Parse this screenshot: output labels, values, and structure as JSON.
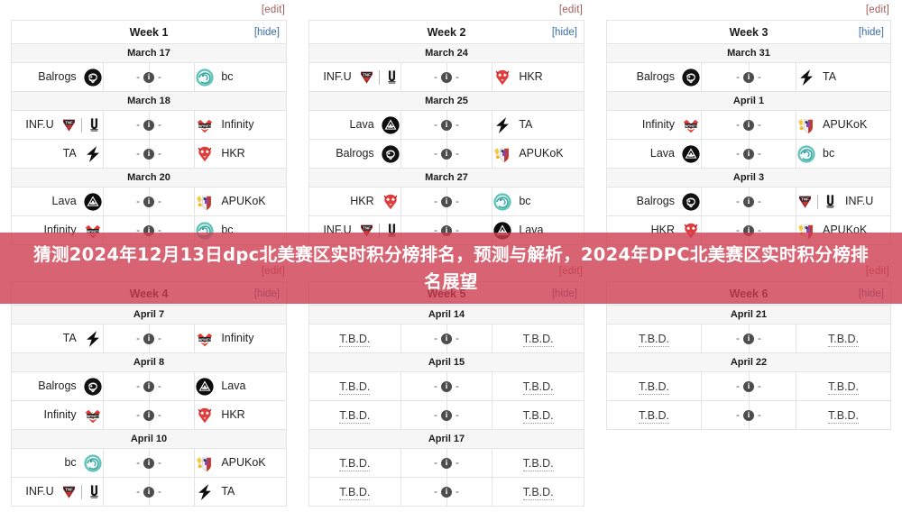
{
  "banner": {
    "text": "猜测2024年12月13日dpc北美赛区实时积分榜排名，预测与解析，2024年DPC北美赛区实时积分榜排名展望",
    "color": "#ce3c50"
  },
  "links": {
    "edit": "[edit]",
    "hide": "[hide]"
  },
  "labels": {
    "tbd": "T.B.D.",
    "score_dash": "-",
    "info": "i"
  },
  "weeks": [
    {
      "title": "Week 1",
      "groups": [
        {
          "date": "March 17",
          "matches": [
            {
              "left": "Balrogs",
              "left_logo": "balrogs-logo",
              "right": "bc",
              "right_logo": "bc-logo"
            }
          ]
        },
        {
          "date": "March 18",
          "matches": [
            {
              "left": "INF.U",
              "left_logo": "infu-dual-logo",
              "right": "Infinity",
              "right_logo": "infinity-logo"
            },
            {
              "left": "TA",
              "left_logo": "ta-logo",
              "right": "HKR",
              "right_logo": "hkr-logo"
            }
          ]
        },
        {
          "date": "March 20",
          "matches": [
            {
              "left": "Lava",
              "left_logo": "lava-logo",
              "right": "APUKoK",
              "right_logo": "apukok-logo"
            },
            {
              "left": "Infinity",
              "left_logo": "infinity-logo",
              "right": "bc",
              "right_logo": "bc-logo"
            }
          ]
        }
      ]
    },
    {
      "title": "Week 2",
      "groups": [
        {
          "date": "March 24",
          "matches": [
            {
              "left": "INF.U",
              "left_logo": "infu-dual-logo",
              "right": "HKR",
              "right_logo": "hkr-logo"
            }
          ]
        },
        {
          "date": "March 25",
          "matches": [
            {
              "left": "Lava",
              "left_logo": "lava-logo",
              "right": "TA",
              "right_logo": "ta-logo"
            },
            {
              "left": "Balrogs",
              "left_logo": "balrogs-logo",
              "right": "APUKoK",
              "right_logo": "apukok-logo"
            }
          ]
        },
        {
          "date": "March 27",
          "matches": [
            {
              "left": "HKR",
              "left_logo": "hkr-logo",
              "right": "bc",
              "right_logo": "bc-logo"
            },
            {
              "left": "INF.U",
              "left_logo": "infu-dual-logo",
              "right": "Lava",
              "right_logo": "lava-logo"
            }
          ]
        }
      ]
    },
    {
      "title": "Week 3",
      "groups": [
        {
          "date": "March 31",
          "matches": [
            {
              "left": "Balrogs",
              "left_logo": "balrogs-logo",
              "right": "TA",
              "right_logo": "ta-logo"
            }
          ]
        },
        {
          "date": "April 1",
          "matches": [
            {
              "left": "Infinity",
              "left_logo": "infinity-logo",
              "right": "APUKoK",
              "right_logo": "apukok-logo"
            },
            {
              "left": "Lava",
              "left_logo": "lava-logo",
              "right": "bc",
              "right_logo": "bc-logo"
            }
          ]
        },
        {
          "date": "April 3",
          "matches": [
            {
              "left": "Balrogs",
              "left_logo": "balrogs-logo",
              "right": "INF.U",
              "right_logo": "infu-dual-logo"
            },
            {
              "left": "HKR",
              "left_logo": "hkr-logo",
              "right": "APUKoK",
              "right_logo": "apukok-logo"
            }
          ]
        }
      ]
    },
    {
      "title": "Week 4",
      "groups": [
        {
          "date": "April 7",
          "matches": [
            {
              "left": "TA",
              "left_logo": "ta-logo",
              "right": "Infinity",
              "right_logo": "infinity-logo"
            }
          ]
        },
        {
          "date": "April 8",
          "matches": [
            {
              "left": "Balrogs",
              "left_logo": "balrogs-logo",
              "right": "Lava",
              "right_logo": "lava-logo"
            },
            {
              "left": "Infinity",
              "left_logo": "infinity-logo",
              "right": "HKR",
              "right_logo": "hkr-logo"
            }
          ]
        },
        {
          "date": "April 10",
          "matches": [
            {
              "left": "bc",
              "left_logo": "bc-logo",
              "right": "APUKoK",
              "right_logo": "apukok-logo"
            },
            {
              "left": "INF.U",
              "left_logo": "infu-dual-logo",
              "right": "TA",
              "right_logo": "ta-logo"
            }
          ]
        }
      ]
    },
    {
      "title": "Week 5",
      "groups": [
        {
          "date": "April 14",
          "matches": [
            {
              "left": "T.B.D.",
              "left_logo": "",
              "right": "T.B.D.",
              "right_logo": ""
            }
          ]
        },
        {
          "date": "April 15",
          "matches": [
            {
              "left": "T.B.D.",
              "left_logo": "",
              "right": "T.B.D.",
              "right_logo": ""
            },
            {
              "left": "T.B.D.",
              "left_logo": "",
              "right": "T.B.D.",
              "right_logo": ""
            }
          ]
        },
        {
          "date": "April 17",
          "matches": [
            {
              "left": "T.B.D.",
              "left_logo": "",
              "right": "T.B.D.",
              "right_logo": ""
            },
            {
              "left": "T.B.D.",
              "left_logo": "",
              "right": "T.B.D.",
              "right_logo": ""
            }
          ]
        }
      ]
    },
    {
      "title": "Week 6",
      "groups": [
        {
          "date": "April 21",
          "matches": [
            {
              "left": "T.B.D.",
              "left_logo": "",
              "right": "T.B.D.",
              "right_logo": ""
            }
          ]
        },
        {
          "date": "April 22",
          "matches": [
            {
              "left": "T.B.D.",
              "left_logo": "",
              "right": "T.B.D.",
              "right_logo": ""
            },
            {
              "left": "T.B.D.",
              "left_logo": "",
              "right": "T.B.D.",
              "right_logo": ""
            }
          ]
        }
      ]
    }
  ]
}
